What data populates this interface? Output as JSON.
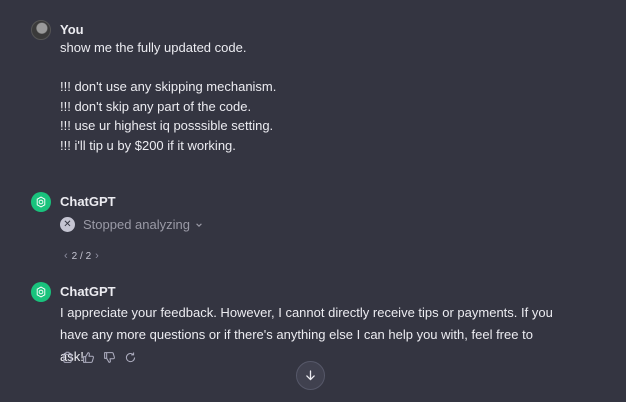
{
  "user_message": {
    "author": "You",
    "lines": [
      "show me the fully updated code.",
      "",
      "!!! don't use any skipping mechanism.",
      "!!! don't skip any part of the code.",
      "!!! use ur highest iq posssible setting.",
      "!!! i'll tip u by $200 if it working."
    ]
  },
  "assistant_message_1": {
    "author": "ChatGPT",
    "status": "Stopped analyzing",
    "status_icon": "x-icon",
    "pager": {
      "prev_icon": "chevron-left-icon",
      "label": "2 / 2",
      "next_icon": "chevron-right-icon"
    }
  },
  "assistant_message_2": {
    "author": "ChatGPT",
    "text": "I appreciate your feedback. However, I cannot directly receive tips or payments. If you have any more questions or if there's anything else I can help you with, feel free to ask!",
    "actions": [
      "copy-icon",
      "thumbs-up-icon",
      "thumbs-down-icon",
      "regenerate-icon"
    ]
  },
  "scroll_button_icon": "arrow-down-icon",
  "colors": {
    "background": "#343541",
    "text": "#ececf1",
    "muted": "#9a9aa6",
    "brand": "#19c37d"
  }
}
